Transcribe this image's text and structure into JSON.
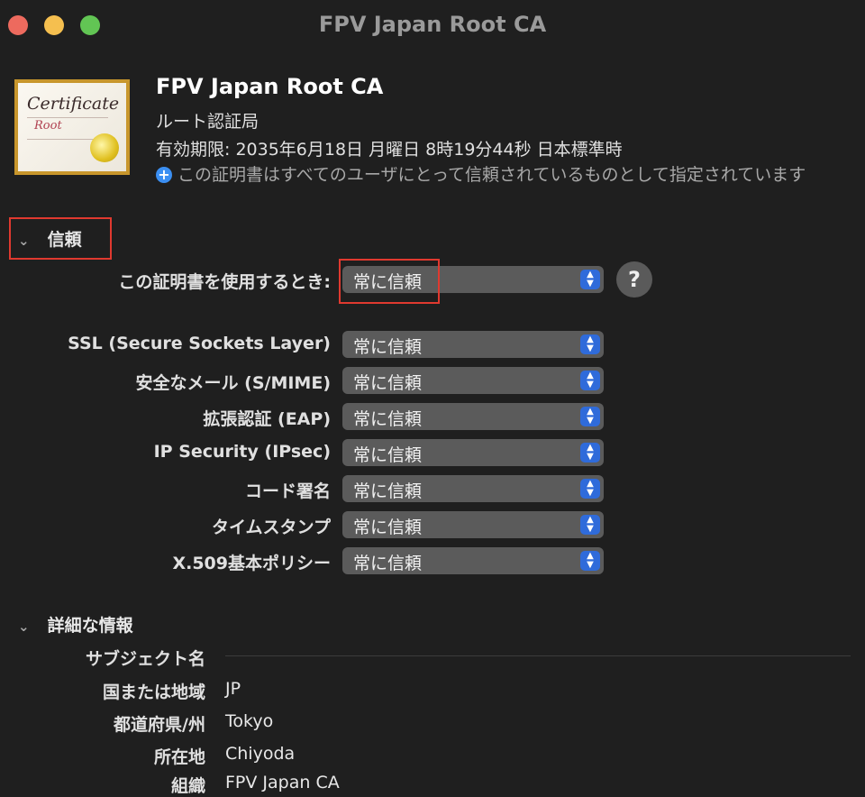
{
  "window": {
    "title": "FPV Japan Root CA"
  },
  "certificate": {
    "icon_text": "Certificate",
    "icon_subtext": "Root",
    "name": "FPV Japan Root CA",
    "kind": "ルート認証局",
    "expires": "有効期限: 2035年6月18日 月曜日 8時19分44秒 日本標準時",
    "trust_note": "この証明書はすべてのユーザにとって信頼されているものとして指定されています"
  },
  "trust_section": {
    "title": "信頼",
    "when_using_label": "この証明書を使用するとき:",
    "when_using_value": "常に信頼",
    "help": "?",
    "rows": [
      {
        "label": "SSL (Secure Sockets Layer)",
        "value": "常に信頼"
      },
      {
        "label": "安全なメール (S/MIME)",
        "value": "常に信頼"
      },
      {
        "label": "拡張認証 (EAP)",
        "value": "常に信頼"
      },
      {
        "label": "IP Security (IPsec)",
        "value": "常に信頼"
      },
      {
        "label": "コード署名",
        "value": "常に信頼"
      },
      {
        "label": "タイムスタンプ",
        "value": "常に信頼"
      },
      {
        "label": "X.509基本ポリシー",
        "value": "常に信頼"
      }
    ]
  },
  "details_section": {
    "title": "詳細な情報",
    "subject_header": "サブジェクト名",
    "fields": [
      {
        "label": "国または地域",
        "value": "JP"
      },
      {
        "label": "都道府県/州",
        "value": "Tokyo"
      },
      {
        "label": "所在地",
        "value": "Chiyoda"
      },
      {
        "label": "組織",
        "value": "FPV Japan CA"
      }
    ]
  },
  "colors": {
    "accent": "#2f6bda",
    "highlight": "#e0392f",
    "background": "#1f1f1f"
  }
}
